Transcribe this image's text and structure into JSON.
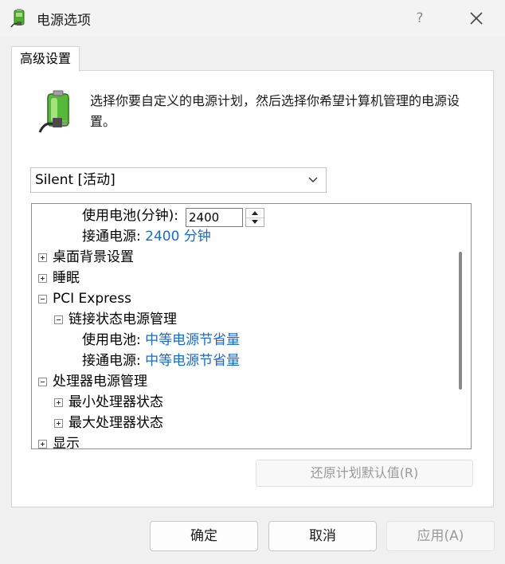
{
  "window": {
    "title": "电源选项",
    "help_label": "?",
    "icon": "battery-plug-icon"
  },
  "tabs": [
    {
      "label": "高级设置"
    }
  ],
  "description": "选择你要自定义的电源计划，然后选择你希望计算机管理的电源设置。",
  "plan_select": {
    "value": "Silent [活动]"
  },
  "tree": {
    "battery_label": "使用电池(分钟):",
    "battery_value": "2400",
    "plugged_label": "接通电源:",
    "plugged_value": "2400 分钟",
    "desktop_bg": "桌面背景设置",
    "sleep": "睡眠",
    "pci": "PCI Express",
    "link_state": "链接状态电源管理",
    "link_battery_label": "使用电池:",
    "link_battery_value": "中等电源节省量",
    "link_plugged_label": "接通电源:",
    "link_plugged_value": "中等电源节省量",
    "processor": "处理器电源管理",
    "min_state": "最小处理器状态",
    "max_state": "最大处理器状态",
    "display": "显示"
  },
  "buttons": {
    "restore": "还原计划默认值(R)",
    "ok": "确定",
    "cancel": "取消",
    "apply": "应用(A)"
  },
  "colors": {
    "value_link": "#1a6ac4",
    "disabled_text": "#9a9a9a"
  }
}
